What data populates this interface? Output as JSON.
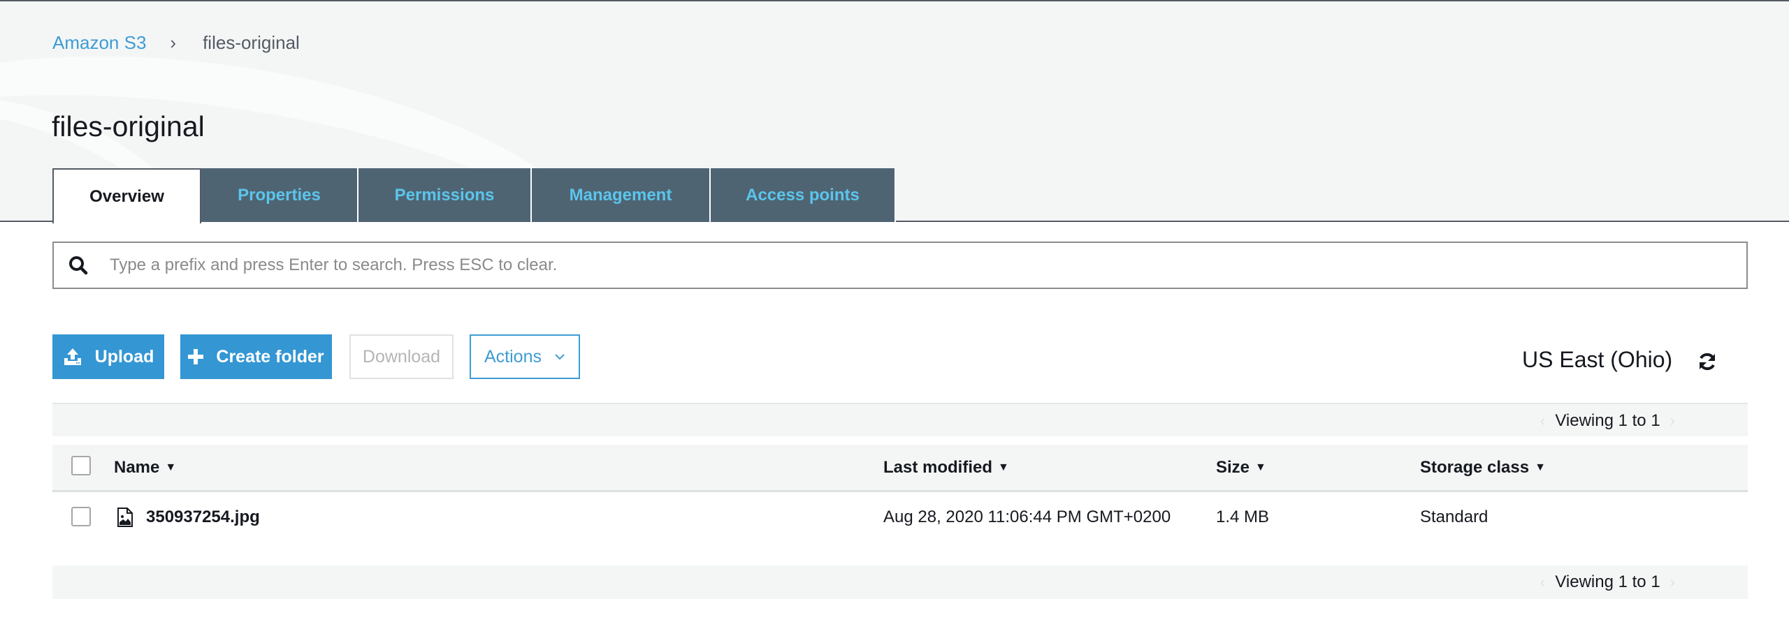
{
  "breadcrumb": {
    "root": "Amazon S3",
    "separator": "›",
    "current": "files-original"
  },
  "page_title": "files-original",
  "tabs": [
    {
      "label": "Overview",
      "active": true
    },
    {
      "label": "Properties",
      "active": false
    },
    {
      "label": "Permissions",
      "active": false
    },
    {
      "label": "Management",
      "active": false
    },
    {
      "label": "Access points",
      "active": false
    }
  ],
  "search": {
    "placeholder": "Type a prefix and press Enter to search. Press ESC to clear.",
    "value": ""
  },
  "toolbar": {
    "upload_label": "Upload",
    "create_folder_label": "Create folder",
    "download_label": "Download",
    "actions_label": "Actions",
    "region": "US East (Ohio)"
  },
  "pagination": {
    "top": "Viewing 1 to 1",
    "bottom": "Viewing 1 to 1",
    "prev": "‹",
    "next": "›"
  },
  "table": {
    "columns": [
      {
        "label": "Name",
        "caret": "▼"
      },
      {
        "label": "Last modified",
        "caret": "▼"
      },
      {
        "label": "Size",
        "caret": "▼"
      },
      {
        "label": "Storage class",
        "caret": "▼"
      }
    ],
    "rows": [
      {
        "icon": "image-file-icon",
        "name": "350937254.jpg",
        "last_modified": "Aug 28, 2020 11:06:44 PM GMT+0200",
        "size": "1.4 MB",
        "storage_class": "Standard"
      }
    ]
  },
  "colors": {
    "link": "#3e9cd3",
    "primary_button": "#3496d3",
    "tab_inactive_bg": "#4f6473",
    "tab_inactive_text": "#5bc5ec",
    "header_bg": "#f4f6f6"
  }
}
